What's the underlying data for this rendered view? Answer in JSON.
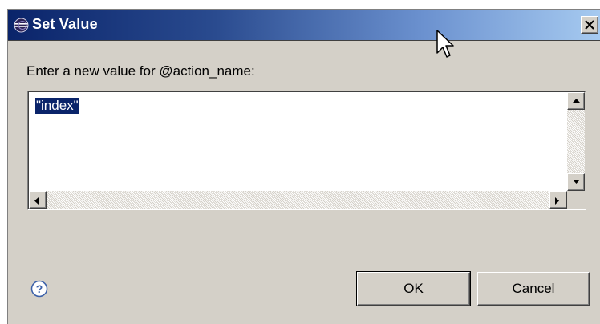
{
  "dialog": {
    "title": "Set Value",
    "prompt": "Enter a new value for @action_name:",
    "value": "\"index\"",
    "ok_label": "OK",
    "cancel_label": "Cancel"
  },
  "icons": {
    "title_icon": "eclipse-icon",
    "close": "close-icon",
    "help": "help-icon",
    "scroll_up": "arrow-up-icon",
    "scroll_down": "arrow-down-icon",
    "scroll_left": "arrow-left-icon",
    "scroll_right": "arrow-right-icon",
    "cursor": "mouse-pointer-icon"
  },
  "colors": {
    "titlebar_start": "#0a246a",
    "titlebar_end": "#a6caf0",
    "selection": "#0a246a",
    "dialog_bg": "#d4d0c8"
  }
}
